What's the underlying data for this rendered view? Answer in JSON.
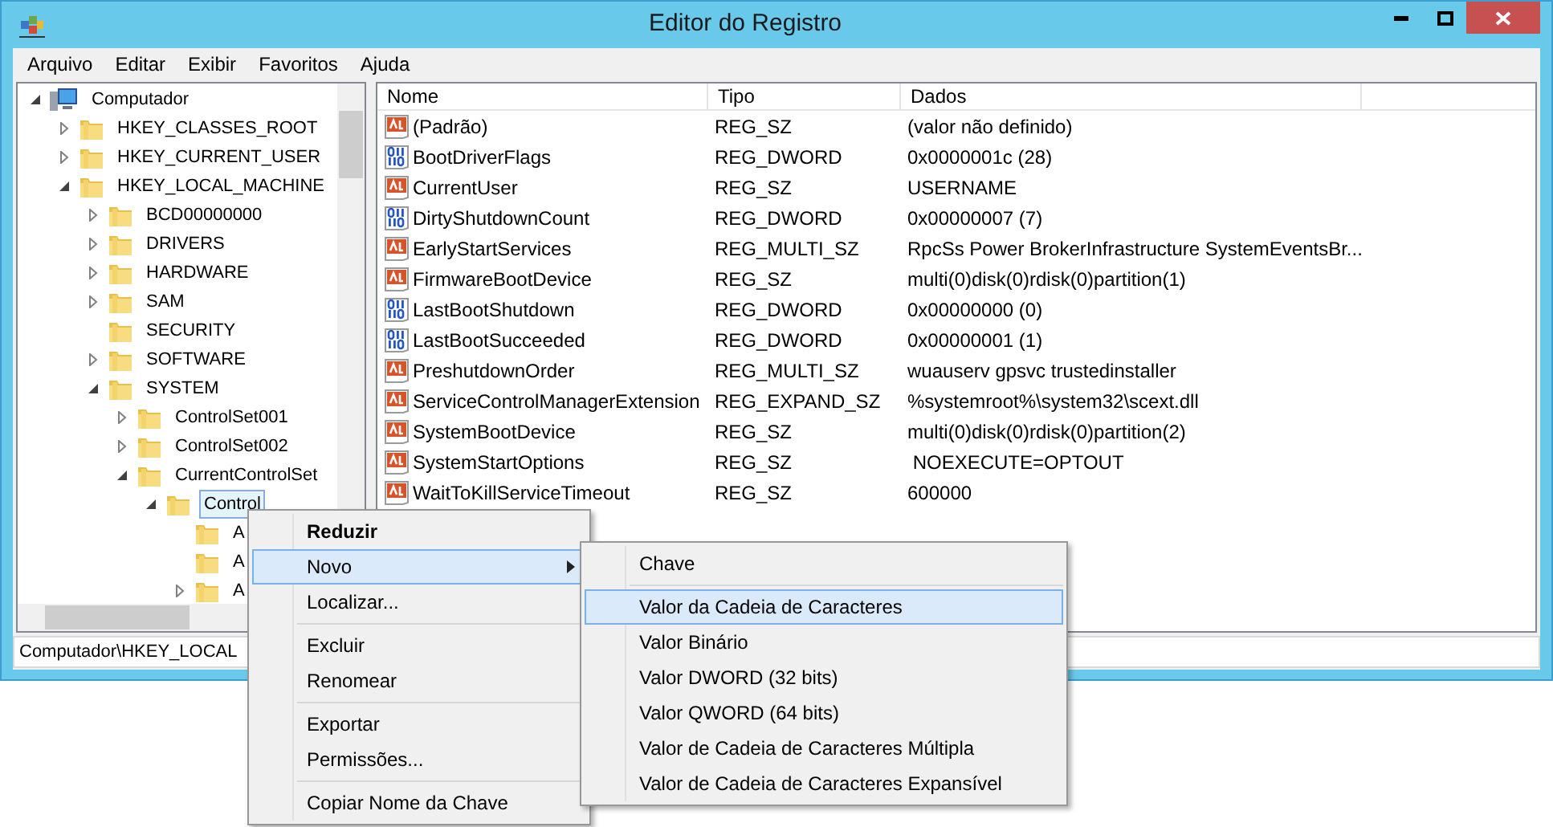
{
  "window": {
    "title": "Editor do Registro"
  },
  "menu_bar": [
    "Arquivo",
    "Editar",
    "Exibir",
    "Favoritos",
    "Ajuda"
  ],
  "tree": [
    {
      "label": "Computador",
      "kind": "computer",
      "expandable": true,
      "expanded": true,
      "selected": false,
      "children": [
        {
          "label": "HKEY_CLASSES_ROOT",
          "kind": "folder",
          "expandable": true,
          "expanded": false,
          "selected": false
        },
        {
          "label": "HKEY_CURRENT_USER",
          "kind": "folder",
          "expandable": true,
          "expanded": false,
          "selected": false
        },
        {
          "label": "HKEY_LOCAL_MACHINE",
          "kind": "folder",
          "expandable": true,
          "expanded": true,
          "selected": false,
          "children": [
            {
              "label": "BCD00000000",
              "kind": "folder",
              "expandable": true,
              "expanded": false,
              "selected": false
            },
            {
              "label": "DRIVERS",
              "kind": "folder",
              "expandable": true,
              "expanded": false,
              "selected": false
            },
            {
              "label": "HARDWARE",
              "kind": "folder",
              "expandable": true,
              "expanded": false,
              "selected": false
            },
            {
              "label": "SAM",
              "kind": "folder",
              "expandable": true,
              "expanded": false,
              "selected": false
            },
            {
              "label": "SECURITY",
              "kind": "folder",
              "expandable": false,
              "selected": false
            },
            {
              "label": "SOFTWARE",
              "kind": "folder",
              "expandable": true,
              "expanded": false,
              "selected": false
            },
            {
              "label": "SYSTEM",
              "kind": "folder",
              "expandable": true,
              "expanded": true,
              "selected": false,
              "children": [
                {
                  "label": "ControlSet001",
                  "kind": "folder",
                  "expandable": true,
                  "expanded": false,
                  "selected": false
                },
                {
                  "label": "ControlSet002",
                  "kind": "folder",
                  "expandable": true,
                  "expanded": false,
                  "selected": false
                },
                {
                  "label": "CurrentControlSet",
                  "kind": "folder",
                  "expandable": true,
                  "expanded": true,
                  "selected": false,
                  "children": [
                    {
                      "label": "Control",
                      "kind": "folder",
                      "expandable": true,
                      "expanded": true,
                      "selected": true,
                      "children": [
                        {
                          "label": "A",
                          "kind": "folder",
                          "expandable": false,
                          "selected": false
                        },
                        {
                          "label": "A",
                          "kind": "folder",
                          "expandable": false,
                          "selected": false
                        },
                        {
                          "label": "A",
                          "kind": "folder",
                          "expandable": true,
                          "expanded": false,
                          "selected": false
                        }
                      ]
                    }
                  ]
                }
              ]
            }
          ]
        }
      ]
    }
  ],
  "table": {
    "columns": [
      "Nome",
      "Tipo",
      "Dados"
    ],
    "rows": [
      {
        "name": "(Padrão)",
        "kind": "string",
        "type": "REG_SZ",
        "data": "(valor não definido)"
      },
      {
        "name": "BootDriverFlags",
        "kind": "binary",
        "type": "REG_DWORD",
        "data": "0x0000001c (28)"
      },
      {
        "name": "CurrentUser",
        "kind": "string",
        "type": "REG_SZ",
        "data": "USERNAME"
      },
      {
        "name": "DirtyShutdownCount",
        "kind": "binary",
        "type": "REG_DWORD",
        "data": "0x00000007 (7)"
      },
      {
        "name": "EarlyStartServices",
        "kind": "string",
        "type": "REG_MULTI_SZ",
        "data": "RpcSs Power BrokerInfrastructure SystemEventsBr..."
      },
      {
        "name": "FirmwareBootDevice",
        "kind": "string",
        "type": "REG_SZ",
        "data": "multi(0)disk(0)rdisk(0)partition(1)"
      },
      {
        "name": "LastBootShutdown",
        "kind": "binary",
        "type": "REG_DWORD",
        "data": "0x00000000 (0)"
      },
      {
        "name": "LastBootSucceeded",
        "kind": "binary",
        "type": "REG_DWORD",
        "data": "0x00000001 (1)"
      },
      {
        "name": "PreshutdownOrder",
        "kind": "string",
        "type": "REG_MULTI_SZ",
        "data": "wuauserv gpsvc trustedinstaller"
      },
      {
        "name": "ServiceControlManagerExtension",
        "kind": "string",
        "type": "REG_EXPAND_SZ",
        "data": "%systemroot%\\system32\\scext.dll"
      },
      {
        "name": "SystemBootDevice",
        "kind": "string",
        "type": "REG_SZ",
        "data": "multi(0)disk(0)rdisk(0)partition(2)"
      },
      {
        "name": "SystemStartOptions",
        "kind": "string",
        "type": "REG_SZ",
        "data": " NOEXECUTE=OPTOUT"
      },
      {
        "name": "WaitToKillServiceTimeout",
        "kind": "string",
        "type": "REG_SZ",
        "data": "600000"
      }
    ]
  },
  "status_bar": "Computador\\HKEY_LOCAL",
  "context_menu": {
    "groups": [
      [
        {
          "label": "Reduzir",
          "default": true,
          "selected": false,
          "submenu": false
        },
        {
          "label": "Novo",
          "default": false,
          "selected": true,
          "submenu": true
        },
        {
          "label": "Localizar...",
          "default": false,
          "selected": false,
          "submenu": false
        }
      ],
      [
        {
          "label": "Excluir",
          "default": false,
          "selected": false,
          "submenu": false
        },
        {
          "label": "Renomear",
          "default": false,
          "selected": false,
          "submenu": false
        }
      ],
      [
        {
          "label": "Exportar",
          "default": false,
          "selected": false,
          "submenu": false
        },
        {
          "label": "Permissões...",
          "default": false,
          "selected": false,
          "submenu": false
        }
      ],
      [
        {
          "label": "Copiar Nome da Chave",
          "default": false,
          "selected": false,
          "submenu": false
        }
      ]
    ]
  },
  "submenu": {
    "groups": [
      [
        {
          "label": "Chave",
          "selected": false
        }
      ],
      [
        {
          "label": "Valor da Cadeia de Caracteres",
          "selected": true
        },
        {
          "label": "Valor Binário",
          "selected": false
        },
        {
          "label": "Valor DWORD (32 bits)",
          "selected": false
        },
        {
          "label": "Valor QWORD (64 bits)",
          "selected": false
        },
        {
          "label": "Valor de Cadeia de Caracteres Múltipla",
          "selected": false
        },
        {
          "label": "Valor de Cadeia de Caracteres Expansível",
          "selected": false
        }
      ]
    ]
  }
}
